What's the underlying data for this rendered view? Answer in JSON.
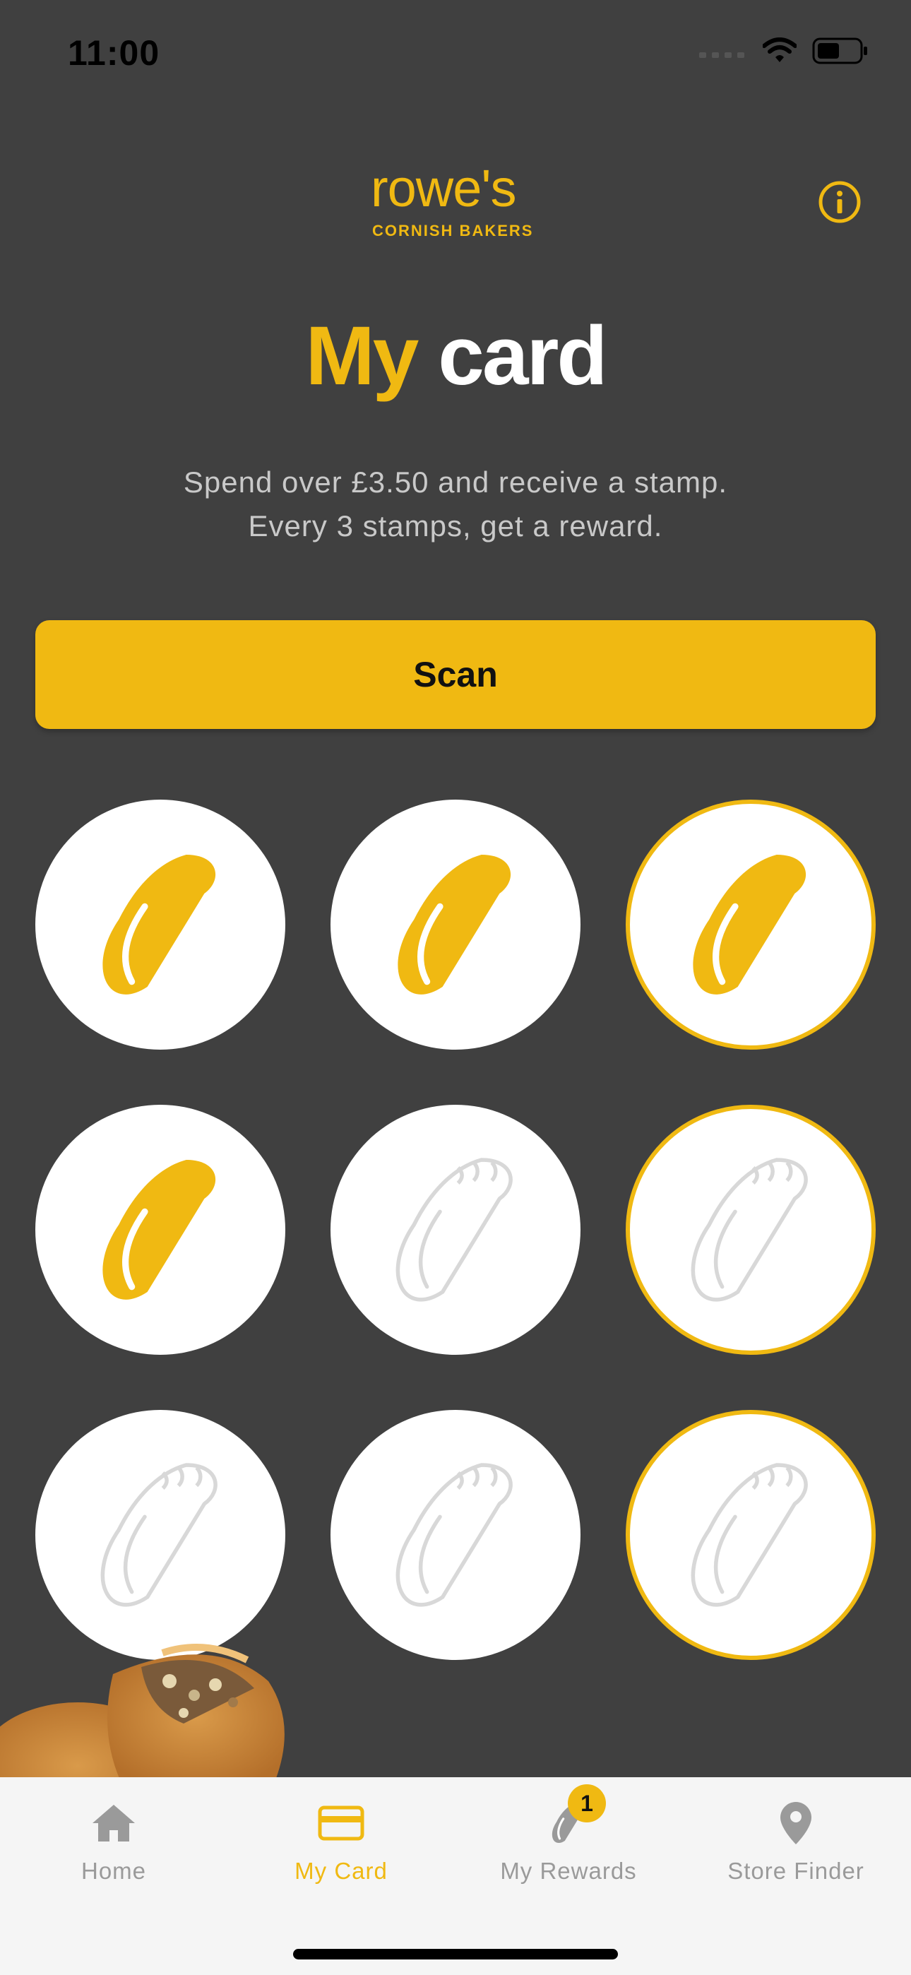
{
  "status_bar": {
    "time": "11:00"
  },
  "header": {
    "logo_word": "rowe's",
    "logo_sub": "CORNISH BAKERS"
  },
  "title": {
    "my": "My",
    "card": "card"
  },
  "subtitle": {
    "line1": "Spend over £3.50 and receive a stamp.",
    "line2": "Every 3 stamps, get a reward."
  },
  "scan_button": {
    "label": "Scan"
  },
  "stamps": {
    "total": 9,
    "collected": 4,
    "reward_every": 3
  },
  "tabs": [
    {
      "label": "Home",
      "icon": "home-icon",
      "active": false
    },
    {
      "label": "My Card",
      "icon": "card-icon",
      "active": true
    },
    {
      "label": "My Rewards",
      "icon": "pasty-icon",
      "active": false,
      "badge": "1"
    },
    {
      "label": "Store Finder",
      "icon": "location-pin-icon",
      "active": false
    }
  ],
  "colors": {
    "background": "#404040",
    "accent": "#f0b912",
    "stamp_empty_outline": "#d8d8d8",
    "tab_bar": "#f5f5f5",
    "tab_inactive": "#9a9a9a"
  }
}
